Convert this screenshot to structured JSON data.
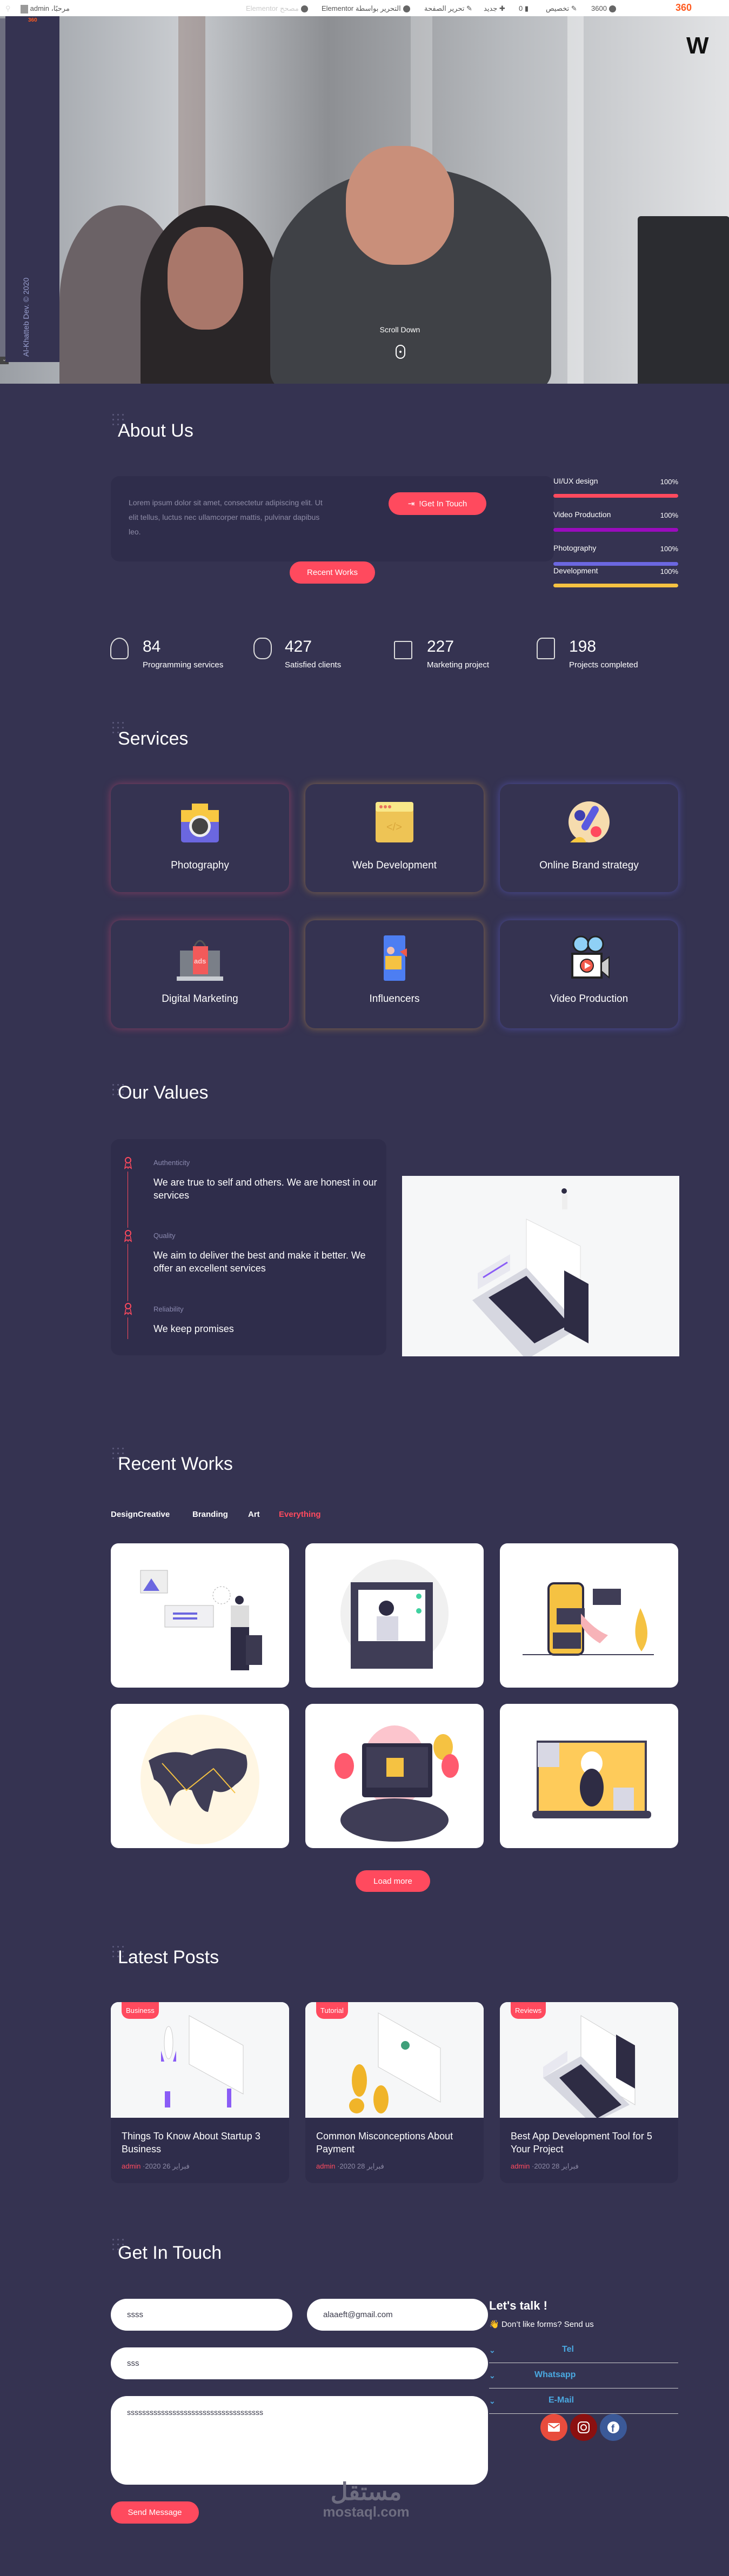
{
  "adminbar": {
    "site_logo": "360",
    "site_name": "3600",
    "customize": "تخصيص",
    "comments_count": "0",
    "new": "جديد",
    "edit_page": "تحرير الصفحة",
    "edit_elementor": "التحرير بواسطة Elementor",
    "elementor_debugger": "مصحح Elementor",
    "greeting": "مرحبًا، admin"
  },
  "hero": {
    "side_logo": "360",
    "copyright": "Al-Khatteb Dev. © 2020",
    "corner_text": "W",
    "scroll_down": "Scroll Down"
  },
  "about": {
    "title": "About Us",
    "text": "Lorem ipsum dolor sit amet, consectetur adipiscing elit. Ut elit tellus, luctus nec ullamcorper mattis, pulvinar dapibus leo.",
    "get_in_touch": "!Get In Touch",
    "recent_works": "Recent Works",
    "skills": [
      {
        "label": "UI/UX design",
        "percent": "100%",
        "value": 100,
        "color": "#ff4a5e"
      },
      {
        "label": "Video Production",
        "percent": "100%",
        "value": 100,
        "color": "#9b0bbd"
      },
      {
        "label": "Photography",
        "percent": "100%",
        "value": 100,
        "color": "#6b67e0"
      },
      {
        "label": "Development",
        "percent": "100%",
        "value": 100,
        "color": "#f5c242"
      }
    ]
  },
  "stats": [
    {
      "icon": "award-icon",
      "number": "84",
      "label": "Programming services"
    },
    {
      "icon": "user-icon",
      "number": "427",
      "label": "Satisfied clients"
    },
    {
      "icon": "coffee-icon",
      "number": "227",
      "label": "Marketing project"
    },
    {
      "icon": "thumbs-up-icon",
      "number": "198",
      "label": "Projects completed"
    }
  ],
  "services": {
    "title": "Services",
    "items": [
      {
        "label": "Photography",
        "icon": "camera-icon",
        "glow": "#8a3f63"
      },
      {
        "label": "Web Development",
        "icon": "code-window-icon",
        "glow": "#8a6a4a"
      },
      {
        "label": "Online Brand strategy",
        "icon": "brand-strategy-icon",
        "glow": "#4e4ea0"
      },
      {
        "label": "Digital Marketing",
        "icon": "ads-bag-icon",
        "glow": "#8a3f63"
      },
      {
        "label": "Influencers",
        "icon": "influencer-phone-icon",
        "glow": "#8a6a4a"
      },
      {
        "label": "Video Production",
        "icon": "video-camera-icon",
        "glow": "#4e4ea0"
      }
    ]
  },
  "values": {
    "title": "Our Values",
    "items": [
      {
        "label": "Authenticity",
        "text": "We are true to self and others. We are honest in our services"
      },
      {
        "label": "Quality",
        "text": "We aim to deliver the best and make it better. We offer an excellent services"
      },
      {
        "label": "Reliability",
        "text": "We keep promises"
      }
    ]
  },
  "works": {
    "title": "Recent Works",
    "tabs": [
      {
        "label": "DesignCreative",
        "active": false
      },
      {
        "label": "Branding",
        "active": false
      },
      {
        "label": "Art",
        "active": false
      },
      {
        "label": "Everything",
        "active": true
      }
    ],
    "load_more": "Load more"
  },
  "posts": {
    "title": "Latest Posts",
    "items": [
      {
        "tag": "Business",
        "title": "Things To Know About Startup 3 Business",
        "author": "admin",
        "date": "·2020 فبراير 26"
      },
      {
        "tag": "Tutorial",
        "title": "Common Misconceptions About Payment",
        "author": "admin",
        "date": "·2020 فبراير 28"
      },
      {
        "tag": "Reviews",
        "title": "Best App Development Tool for 5 Your Project",
        "author": "admin",
        "date": "·2020 فبراير 28"
      }
    ]
  },
  "contact": {
    "title": "Get In Touch",
    "name_value": "ssss",
    "email_value": "alaaeft@gmail.com",
    "subject_value": "sss",
    "message_value": "ssssssssssssssssssssssssssssssssssss",
    "send": "Send Message",
    "lets_talk": "Let's talk !",
    "subtitle": "👋 Don’t like forms? Send us",
    "rows": [
      "Tel",
      "Whatsapp",
      "E-Mail"
    ],
    "social": [
      {
        "icon": "email-icon",
        "color": "#e84c3d"
      },
      {
        "icon": "instagram-icon",
        "color": "#8b1010"
      },
      {
        "icon": "facebook-icon",
        "color": "#3b5998"
      }
    ]
  },
  "watermark": {
    "arabic": "مستقل",
    "latin": "mostaql.com"
  },
  "colors": {
    "background": "#353351",
    "card": "#2f2d4b",
    "accent": "#ff4a5e"
  }
}
